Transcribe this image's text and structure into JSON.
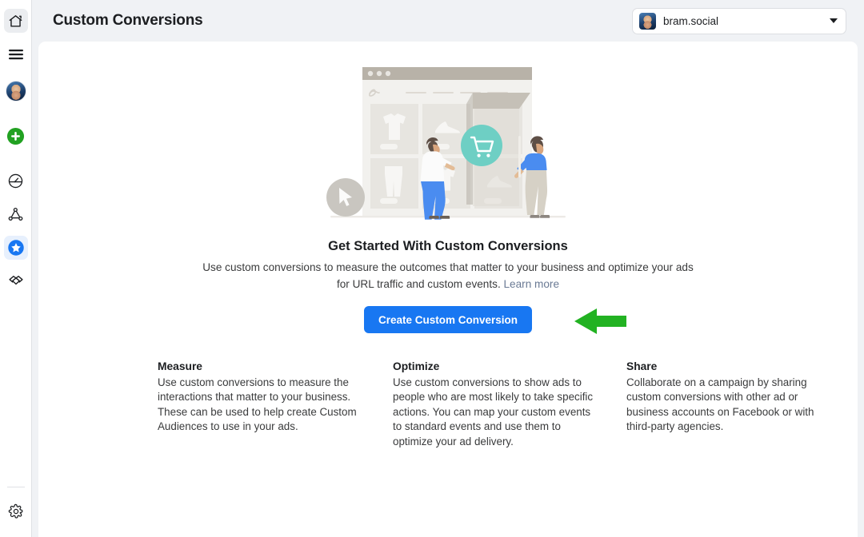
{
  "sidebar": {
    "items": [
      {
        "name": "home",
        "icon": "home-icon",
        "active": true
      },
      {
        "name": "menu",
        "icon": "hamburger-menu-icon",
        "active": false
      },
      {
        "name": "profile",
        "icon": "avatar",
        "active": false
      },
      {
        "name": "create",
        "icon": "plus-circle-icon",
        "active": false
      },
      {
        "name": "performance",
        "icon": "gauge-icon",
        "active": false
      },
      {
        "name": "audiences",
        "icon": "network-nodes-icon",
        "active": false
      },
      {
        "name": "custom-conversions",
        "icon": "star-circle-icon",
        "active": true
      },
      {
        "name": "partnerships",
        "icon": "handshake-icon",
        "active": false
      }
    ],
    "settings": {
      "icon": "gear-icon"
    }
  },
  "header": {
    "title": "Custom Conversions",
    "account": {
      "name": "bram.social",
      "caret": "chevron-down-icon"
    }
  },
  "hero": {
    "title": "Get Started With Custom Conversions",
    "description": "Use custom conversions to measure the outcomes that matter to your business and optimize your ads for URL traffic and custom events.",
    "learn_more": "Learn more",
    "cta_label": "Create Custom Conversion"
  },
  "features": [
    {
      "title": "Measure",
      "body": "Use custom conversions to measure the interactions that matter to your business. These can be used to help create Custom Audiences to use in your ads."
    },
    {
      "title": "Optimize",
      "body": "Use custom conversions to show ads to people who are most likely to take specific actions. You can map your custom events to standard events and use them to optimize your ad delivery."
    },
    {
      "title": "Share",
      "body": "Collaborate on a campaign by sharing custom conversions with other ad or business accounts on Facebook or with third-party agencies."
    }
  ],
  "annotation": {
    "type": "arrow-left",
    "color": "#22b222",
    "points_at": "create-custom-conversion-button"
  },
  "colors": {
    "accent_blue": "#1877f2",
    "page_background": "#f0f2f5",
    "card_background": "#ffffff",
    "text_primary": "#1c1e21",
    "text_secondary": "#3a3b3c",
    "link": "#6a7a94",
    "annotation_green": "#22b222",
    "illustration_teal": "#6ecfc4"
  }
}
